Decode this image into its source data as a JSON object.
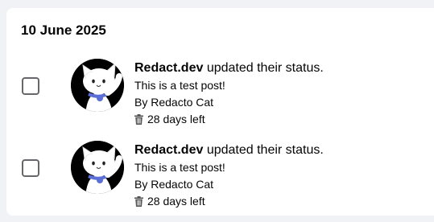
{
  "date_heading": "10 June 2025",
  "items": [
    {
      "author": "Redact.dev",
      "action": " updated their status.",
      "post_text": "This is a test post!",
      "byline": "By Redacto Cat",
      "expiry": "28 days left",
      "avatar_icon": "cat-avatar-icon",
      "expiry_icon": "trash-icon"
    },
    {
      "author": "Redact.dev",
      "action": " updated their status.",
      "post_text": "This is a test post!",
      "byline": "By Redacto Cat",
      "expiry": "28 days left",
      "avatar_icon": "cat-avatar-icon",
      "expiry_icon": "trash-icon"
    }
  ],
  "colors": {
    "background": "#f0f2f5",
    "panel": "#ffffff",
    "text": "#050505",
    "checkbox_border": "#65676b",
    "collar": "#5b6fd6"
  }
}
